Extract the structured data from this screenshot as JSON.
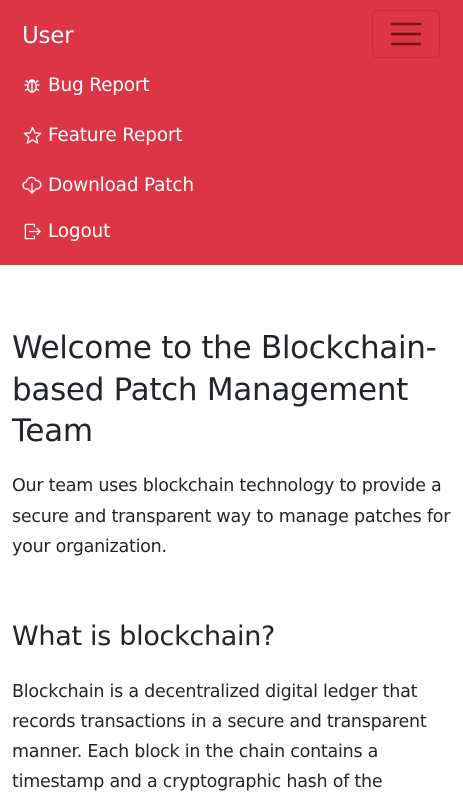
{
  "navbar": {
    "brand": "User",
    "toggle_icon": "hamburger-menu-icon",
    "items": [
      {
        "label": "Bug Report",
        "icon": "bug-icon"
      },
      {
        "label": "Feature Report",
        "icon": "star-icon"
      },
      {
        "label": "Download Patch",
        "icon": "cloud-download-icon"
      },
      {
        "label": "Logout",
        "icon": "logout-icon"
      }
    ],
    "color": "#dc3545"
  },
  "main": {
    "heading": "Welcome to the Blockchain-based Patch Management Team",
    "intro": "Our team uses blockchain technology to provide a secure and transparent way to manage patches for your organization.",
    "section_heading": "What is blockchain?",
    "section_text": "Blockchain is a decentralized digital ledger that records transactions in a secure and transparent manner. Each block in the chain contains a timestamp and a cryptographic hash of the"
  }
}
